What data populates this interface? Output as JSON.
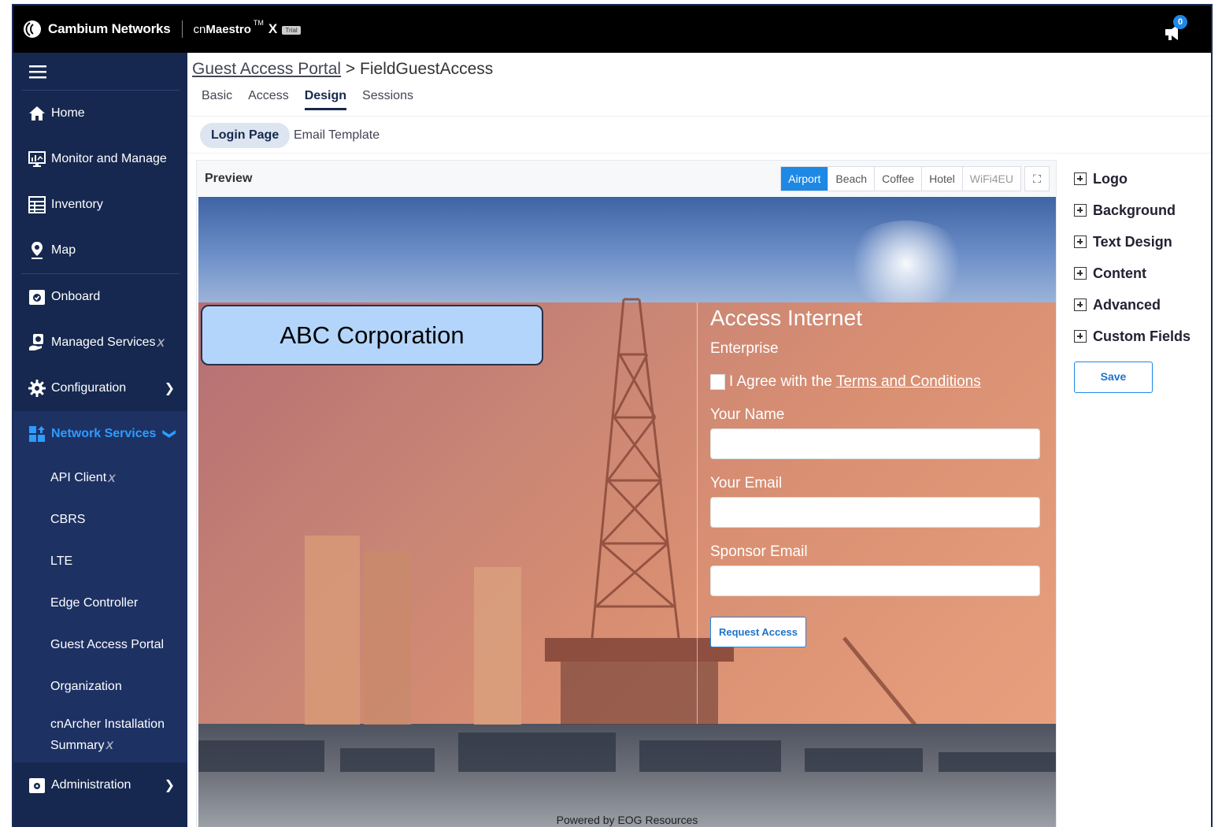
{
  "topbar": {
    "brand": "Cambium Networks",
    "product_cn": "cn",
    "product_name": "Maestro",
    "product_tm": "TM",
    "product_x": "X",
    "trial": "Trial",
    "notification_count": "0"
  },
  "sidebar": {
    "items": [
      {
        "label": "Home",
        "icon": "home-icon"
      },
      {
        "label": "Monitor and Manage",
        "icon": "monitor-icon"
      },
      {
        "label": "Inventory",
        "icon": "inventory-icon"
      },
      {
        "label": "Map",
        "icon": "map-pin-icon"
      },
      {
        "label": "Onboard",
        "icon": "onboard-icon"
      },
      {
        "label": "Managed Services",
        "icon": "managed-services-icon"
      },
      {
        "label": "Configuration",
        "icon": "gear-icon"
      },
      {
        "label": "Network Services",
        "icon": "network-services-icon"
      }
    ],
    "sub_items": [
      {
        "label": "API Client"
      },
      {
        "label": "CBRS"
      },
      {
        "label": "LTE"
      },
      {
        "label": "Edge Controller"
      },
      {
        "label": "Guest Access Portal"
      },
      {
        "label": "Organization"
      },
      {
        "label": "cnArcher Installation",
        "label2": "Summary"
      }
    ],
    "administration": "Administration"
  },
  "breadcrumb": {
    "parent": "Guest Access Portal",
    "separator": " > ",
    "current": "FieldGuestAccess"
  },
  "tabs": [
    "Basic",
    "Access",
    "Design",
    "Sessions"
  ],
  "subtabs": [
    "Login Page",
    "Email Template"
  ],
  "preview": {
    "title": "Preview",
    "themes": [
      "Airport",
      "Beach",
      "Coffee",
      "Hotel",
      "WiFi4EU"
    ],
    "active_theme": "Airport",
    "logo_text": "ABC Corporation",
    "form": {
      "title": "Access Internet",
      "subtitle": "Enterprise",
      "agree_text": "I Agree with the",
      "terms_link": "Terms and Conditions",
      "name_label": "Your Name",
      "email_label": "Your Email",
      "sponsor_label": "Sponsor Email",
      "button": "Request Access"
    },
    "footer": "Powered by EOG Resources"
  },
  "right_panel": {
    "items": [
      "Logo",
      "Background",
      "Text Design",
      "Content",
      "Advanced",
      "Custom Fields"
    ],
    "save": "Save"
  },
  "colors": {
    "sidebar_bg": "#16284f",
    "accent": "#1e88e5",
    "active_nav_text": "#2d9cff"
  }
}
